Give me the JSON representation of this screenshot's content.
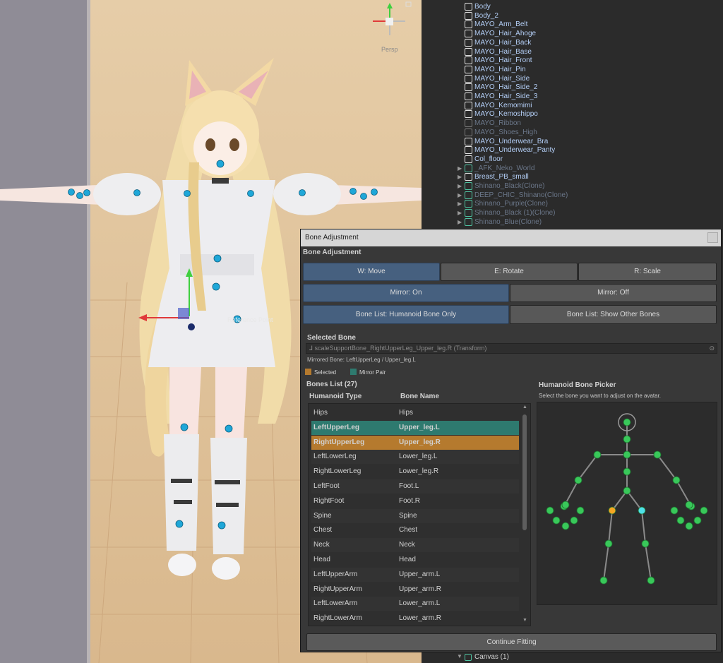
{
  "scene": {
    "gizmo_label": "Persp",
    "pivot_label": "Reference Point"
  },
  "hierarchy": {
    "items": [
      {
        "label": "Body",
        "dim": false,
        "prefab": false,
        "arrow": false
      },
      {
        "label": "Body_2",
        "dim": false,
        "prefab": false,
        "arrow": false
      },
      {
        "label": "MAYO_Arm_Belt",
        "dim": false,
        "prefab": false,
        "arrow": false
      },
      {
        "label": "MAYO_Hair_Ahoge",
        "dim": false,
        "prefab": false,
        "arrow": false
      },
      {
        "label": "MAYO_Hair_Back",
        "dim": false,
        "prefab": false,
        "arrow": false
      },
      {
        "label": "MAYO_Hair_Base",
        "dim": false,
        "prefab": false,
        "arrow": false
      },
      {
        "label": "MAYO_Hair_Front",
        "dim": false,
        "prefab": false,
        "arrow": false
      },
      {
        "label": "MAYO_Hair_Pin",
        "dim": false,
        "prefab": false,
        "arrow": false
      },
      {
        "label": "MAYO_Hair_Side",
        "dim": false,
        "prefab": false,
        "arrow": false
      },
      {
        "label": "MAYO_Hair_Side_2",
        "dim": false,
        "prefab": false,
        "arrow": false
      },
      {
        "label": "MAYO_Hair_Side_3",
        "dim": false,
        "prefab": false,
        "arrow": false
      },
      {
        "label": "MAYO_Kemomimi",
        "dim": false,
        "prefab": false,
        "arrow": false
      },
      {
        "label": "MAYO_Kemoshippo",
        "dim": false,
        "prefab": false,
        "arrow": false
      },
      {
        "label": "MAYO_Ribbon",
        "dim": true,
        "prefab": false,
        "arrow": false
      },
      {
        "label": "MAYO_Shoes_High",
        "dim": true,
        "prefab": false,
        "arrow": false
      },
      {
        "label": "MAYO_Underwear_Bra",
        "dim": false,
        "prefab": false,
        "arrow": false
      },
      {
        "label": "MAYO_Underwear_Panty",
        "dim": false,
        "prefab": false,
        "arrow": false
      },
      {
        "label": "Col_floor",
        "dim": false,
        "prefab": false,
        "arrow": false
      },
      {
        "label": "_AFK_Neko_World",
        "dim": true,
        "prefab": true,
        "arrow": true
      },
      {
        "label": "Breast_PB_small",
        "dim": false,
        "prefab": false,
        "arrow": true
      },
      {
        "label": "Shinano_Black(Clone)",
        "dim": true,
        "prefab": true,
        "arrow": true
      },
      {
        "label": "DEEP_CHIC_Shinano(Clone)",
        "dim": true,
        "prefab": true,
        "arrow": true
      },
      {
        "label": "Shinano_Purple(Clone)",
        "dim": true,
        "prefab": true,
        "arrow": true
      },
      {
        "label": "Shinano_Black (1)(Clone)",
        "dim": true,
        "prefab": true,
        "arrow": true
      },
      {
        "label": "Shinano_Blue(Clone)",
        "dim": true,
        "prefab": true,
        "arrow": true
      }
    ],
    "bottom_item": "Canvas (1)"
  },
  "panel": {
    "window_title": "Bone Adjustment",
    "section_title": "Bone Adjustment",
    "tool_buttons": [
      "W: Move",
      "E: Rotate",
      "R: Scale"
    ],
    "mirror_buttons": [
      "Mirror: On",
      "Mirror: Off"
    ],
    "list_buttons": [
      "Bone List: Humanoid Bone Only",
      "Bone List: Show Other Bones"
    ],
    "selected_bone_label": "Selected Bone",
    "selected_bone_value": "scaleSupportBone_RightUpperLeg_Upper_leg.R (Transform)",
    "mirrored_bone": "Mirrored Bone: LeftUpperLeg / Upper_leg.L",
    "legend_selected": "Selected",
    "legend_mirror": "Mirror Pair",
    "bones_list_title": "Bones List (27)",
    "col_type": "Humanoid Type",
    "col_name": "Bone Name",
    "bones": [
      {
        "type": "Hips",
        "name": "Hips",
        "state": ""
      },
      {
        "type": "LeftUpperLeg",
        "name": "Upper_leg.L",
        "state": "mirror"
      },
      {
        "type": "RightUpperLeg",
        "name": "Upper_leg.R",
        "state": "selected"
      },
      {
        "type": "LeftLowerLeg",
        "name": "Lower_leg.L",
        "state": ""
      },
      {
        "type": "RightLowerLeg",
        "name": "Lower_leg.R",
        "state": ""
      },
      {
        "type": "LeftFoot",
        "name": "Foot.L",
        "state": ""
      },
      {
        "type": "RightFoot",
        "name": "Foot.R",
        "state": ""
      },
      {
        "type": "Spine",
        "name": "Spine",
        "state": ""
      },
      {
        "type": "Chest",
        "name": "Chest",
        "state": ""
      },
      {
        "type": "Neck",
        "name": "Neck",
        "state": ""
      },
      {
        "type": "Head",
        "name": "Head",
        "state": ""
      },
      {
        "type": "LeftUpperArm",
        "name": "Upper_arm.L",
        "state": ""
      },
      {
        "type": "RightUpperArm",
        "name": "Upper_arm.R",
        "state": ""
      },
      {
        "type": "LeftLowerArm",
        "name": "Lower_arm.L",
        "state": ""
      },
      {
        "type": "RightLowerArm",
        "name": "Lower_arm.R",
        "state": ""
      }
    ],
    "picker_title": "Humanoid Bone Picker",
    "picker_hint": "Select the bone you want to adjust on the avatar.",
    "continue_button": "Continue Fitting"
  },
  "colors": {
    "selected": "#b57a2e",
    "mirror": "#2e7a6f",
    "accent": "#46607f",
    "node": "#39c85a",
    "node_selected": "#f5a623",
    "node_mirror": "#4fe0e8"
  }
}
